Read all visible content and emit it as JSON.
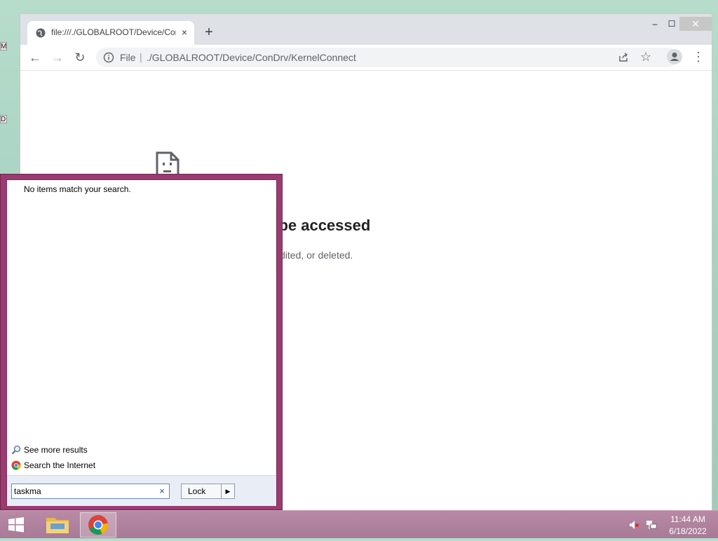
{
  "desktop": {
    "frag1": "M",
    "frag2": "D"
  },
  "browser": {
    "tab_title": "file:///./GLOBALROOT/Device/ConDrv/KernelConnect",
    "tab_close": "×",
    "new_tab": "+",
    "window_controls": {
      "minimize": "–",
      "maximize": "☐",
      "close": "✕"
    },
    "nav": {
      "back": "←",
      "forward": "→",
      "reload": "↻"
    },
    "omnibox": {
      "scheme": "File",
      "separator": "|",
      "url": "./GLOBALROOT/Device/ConDrv/KernelConnect"
    },
    "star": "☆",
    "menu": "⋮",
    "error": {
      "title_fragment": "t be accessed",
      "desc_fragment": "dited, or deleted."
    }
  },
  "start_menu": {
    "no_items": "No items match your search.",
    "see_more": "See more results",
    "search_internet": "Search the Internet",
    "search_value": "taskma",
    "search_clear": "×",
    "lock_label": "Lock",
    "lock_arrow": "▶"
  },
  "taskbar": {
    "time": "11:44 AM",
    "date": "6/18/2022"
  },
  "colors": {
    "start_menu_border": "#9b3b72",
    "taskbar": "#a87a97",
    "chrome_tab_bg": "#dee1e6"
  }
}
